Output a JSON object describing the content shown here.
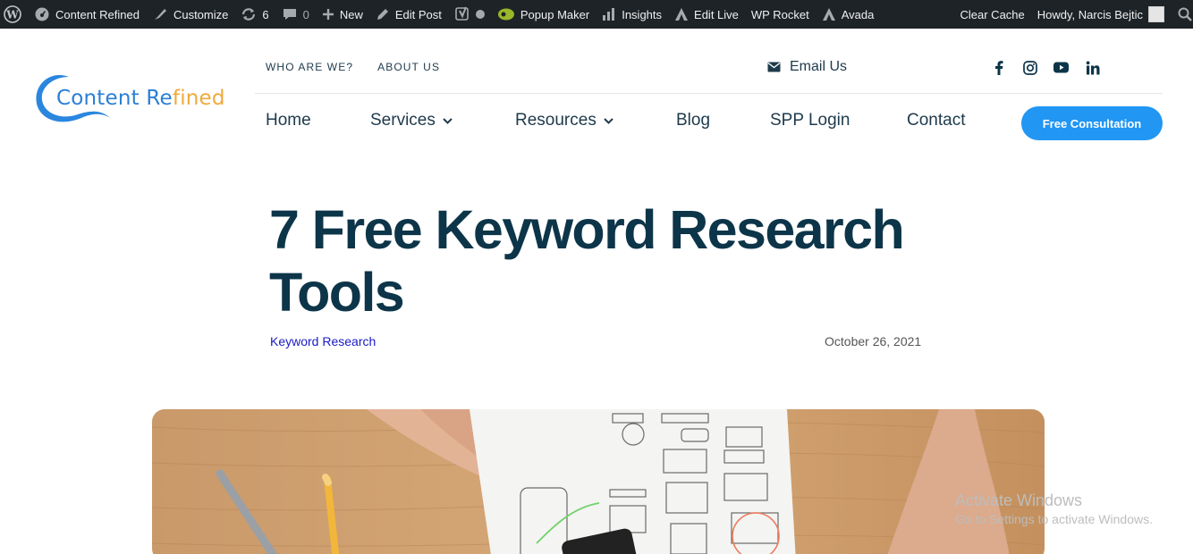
{
  "adminbar": {
    "site_name": "Content Refined",
    "customize": "Customize",
    "updates_count": "6",
    "comments_count": "0",
    "new": "New",
    "edit_post": "Edit Post",
    "popup_maker": "Popup Maker",
    "insights": "Insights",
    "edit_live": "Edit Live",
    "wp_rocket": "WP Rocket",
    "avada": "Avada",
    "clear_cache": "Clear Cache",
    "howdy": "Howdy, Narcis Bejtic"
  },
  "logo": {
    "part1": "Content Re",
    "part2": "fined"
  },
  "topnav": {
    "who": "WHO ARE WE?",
    "about": "ABOUT US"
  },
  "email": {
    "label": "Email Us"
  },
  "social": [
    "facebook-icon",
    "instagram-icon",
    "youtube-icon",
    "linkedin-icon"
  ],
  "mainnav": {
    "home": "Home",
    "services": "Services",
    "resources": "Resources",
    "blog": "Blog",
    "spp": "SPP Login",
    "contact": "Contact",
    "cta": "Free Consultation"
  },
  "article": {
    "title": "7 Free Keyword Research Tools",
    "category": "Keyword Research",
    "date": "October 26, 2021"
  },
  "watermark": {
    "line1": "Activate Windows",
    "line2": "Go to Settings to activate Windows."
  },
  "colors": {
    "brand_blue": "#2196f3",
    "navy": "#0d3549",
    "adminbar": "#1d2327",
    "logo_orange": "#f0a93a"
  }
}
